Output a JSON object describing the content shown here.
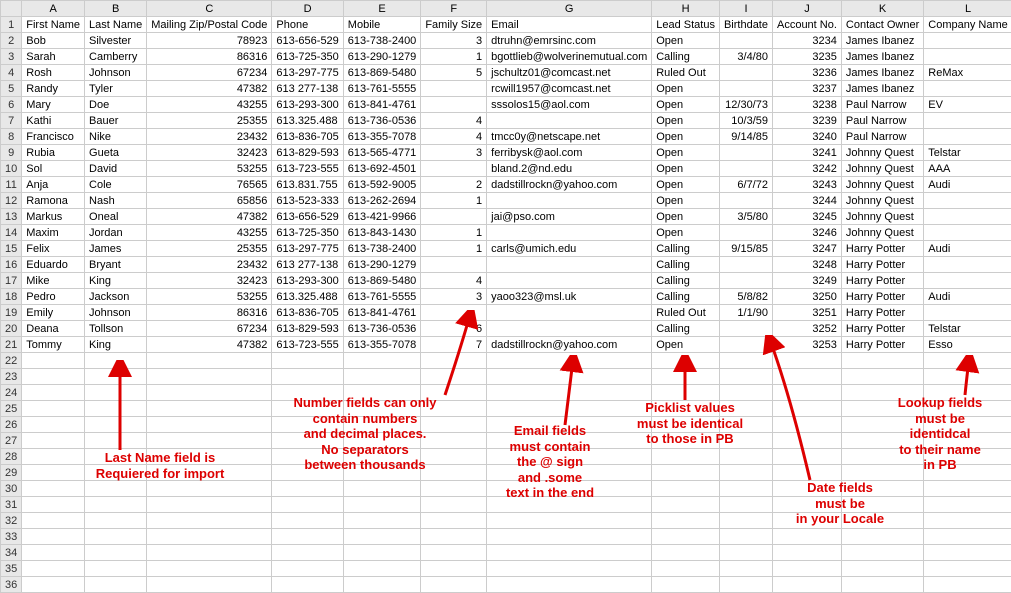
{
  "columns": [
    "A",
    "B",
    "C",
    "D",
    "E",
    "F",
    "G",
    "H",
    "I",
    "J",
    "K",
    "L"
  ],
  "headerRow": [
    "First Name",
    "Last Name",
    "Mailing Zip/Postal Code",
    "Phone",
    "Mobile",
    "Family Size",
    "Email",
    "Lead Status",
    "Birthdate",
    "Account No.",
    "Contact Owner",
    "Company Name"
  ],
  "rows": [
    [
      "Bob",
      "Silvester",
      "78923",
      "613-656-529",
      "613-738-2400",
      "3",
      "dtruhn@emrsinc.com",
      "Open",
      "",
      "3234",
      "James Ibanez",
      ""
    ],
    [
      "Sarah",
      "Camberry",
      "86316",
      "613-725-350",
      "613-290-1279",
      "1",
      "bgottlieb@wolverinemutual.com",
      "Calling",
      "3/4/80",
      "3235",
      "James Ibanez",
      ""
    ],
    [
      "Rosh",
      "Johnson",
      "67234",
      "613-297-775",
      "613-869-5480",
      "5",
      "jschultz01@comcast.net",
      "Ruled Out",
      "",
      "3236",
      "James Ibanez",
      "ReMax"
    ],
    [
      "Randy",
      "Tyler",
      "47382",
      "613 277-138",
      "613-761-5555",
      "",
      "rcwill1957@comcast.net",
      "Open",
      "",
      "3237",
      "James Ibanez",
      ""
    ],
    [
      "Mary",
      "Doe",
      "43255",
      "613-293-300",
      "613-841-4761",
      "",
      "sssolos15@aol.com",
      "Open",
      "12/30/73",
      "3238",
      "Paul Narrow",
      "EV"
    ],
    [
      "Kathi",
      "Bauer",
      "25355",
      "613.325.488",
      "613-736-0536",
      "4",
      "",
      "Open",
      "10/3/59",
      "3239",
      "Paul Narrow",
      ""
    ],
    [
      "Francisco",
      "Nike",
      "23432",
      "613-836-705",
      "613-355-7078",
      "4",
      "tmcc0y@netscape.net",
      "Open",
      "9/14/85",
      "3240",
      "Paul Narrow",
      ""
    ],
    [
      "Rubia",
      "Gueta",
      "32423",
      "613-829-593",
      "613-565-4771",
      "3",
      "ferribysk@aol.com",
      "Open",
      "",
      "3241",
      "Johnny Quest",
      "Telstar"
    ],
    [
      "Sol",
      "David",
      "53255",
      "613-723-555",
      "613-692-4501",
      "",
      "bland.2@nd.edu",
      "Open",
      "",
      "3242",
      "Johnny Quest",
      "AAA"
    ],
    [
      "Anja",
      "Cole",
      "76565",
      "613.831.755",
      "613-592-9005",
      "2",
      "dadstillrockn@yahoo.com",
      "Open",
      "6/7/72",
      "3243",
      "Johnny Quest",
      "Audi"
    ],
    [
      "Ramona",
      "Nash",
      "65856",
      "613-523-333",
      "613-262-2694",
      "1",
      "",
      "Open",
      "",
      "3244",
      "Johnny Quest",
      ""
    ],
    [
      "Markus",
      "Oneal",
      "47382",
      "613-656-529",
      "613-421-9966",
      "",
      "jai@pso.com",
      "Open",
      "3/5/80",
      "3245",
      "Johnny Quest",
      ""
    ],
    [
      "Maxim",
      "Jordan",
      "43255",
      "613-725-350",
      "613-843-1430",
      "1",
      "",
      "Open",
      "",
      "3246",
      "Johnny Quest",
      ""
    ],
    [
      "Felix",
      "James",
      "25355",
      "613-297-775",
      "613-738-2400",
      "1",
      "carls@umich.edu",
      "Calling",
      "9/15/85",
      "3247",
      "Harry Potter",
      "Audi"
    ],
    [
      "Eduardo",
      "Bryant",
      "23432",
      "613 277-138",
      "613-290-1279",
      "",
      "",
      "Calling",
      "",
      "3248",
      "Harry Potter",
      ""
    ],
    [
      "Mike",
      "King",
      "32423",
      "613-293-300",
      "613-869-5480",
      "4",
      "",
      "Calling",
      "",
      "3249",
      "Harry Potter",
      ""
    ],
    [
      "Pedro",
      "Jackson",
      "53255",
      "613.325.488",
      "613-761-5555",
      "3",
      "yaoo323@msl.uk",
      "Calling",
      "5/8/82",
      "3250",
      "Harry Potter",
      "Audi"
    ],
    [
      "Emily",
      "Johnson",
      "86316",
      "613-836-705",
      "613-841-4761",
      "",
      "",
      "Ruled Out",
      "1/1/90",
      "3251",
      "Harry Potter",
      ""
    ],
    [
      "Deana",
      "Tollson",
      "67234",
      "613-829-593",
      "613-736-0536",
      "6",
      "",
      "Calling",
      "",
      "3252",
      "Harry Potter",
      "Telstar"
    ],
    [
      "Tommy",
      "King",
      "47382",
      "613-723-555",
      "613-355-7078",
      "7",
      "dadstillrockn@yahoo.com",
      "Open",
      "",
      "3253",
      "Harry Potter",
      "Esso"
    ]
  ],
  "annotations": {
    "lastName": "Last Name field is\nRequiered for import",
    "numberFields": "Number fields can only\ncontain numbers\nand decimal places.\nNo separators\nbetween  thousands",
    "emailFields": "Email fields\nmust contain\nthe @ sign\nand .some\ntext in the end",
    "picklist": "Picklist values\nmust be identical\nto those in PB",
    "dateFields": "Date fields\nmust be\nin your Locale",
    "lookup": "Lookup fields\nmust be\nidentidcal\nto their name\nin PB"
  },
  "numericCols": [
    2,
    5,
    9
  ],
  "rightCols": [
    8
  ],
  "emptyRowsStart": 22,
  "emptyRowsEnd": 36
}
